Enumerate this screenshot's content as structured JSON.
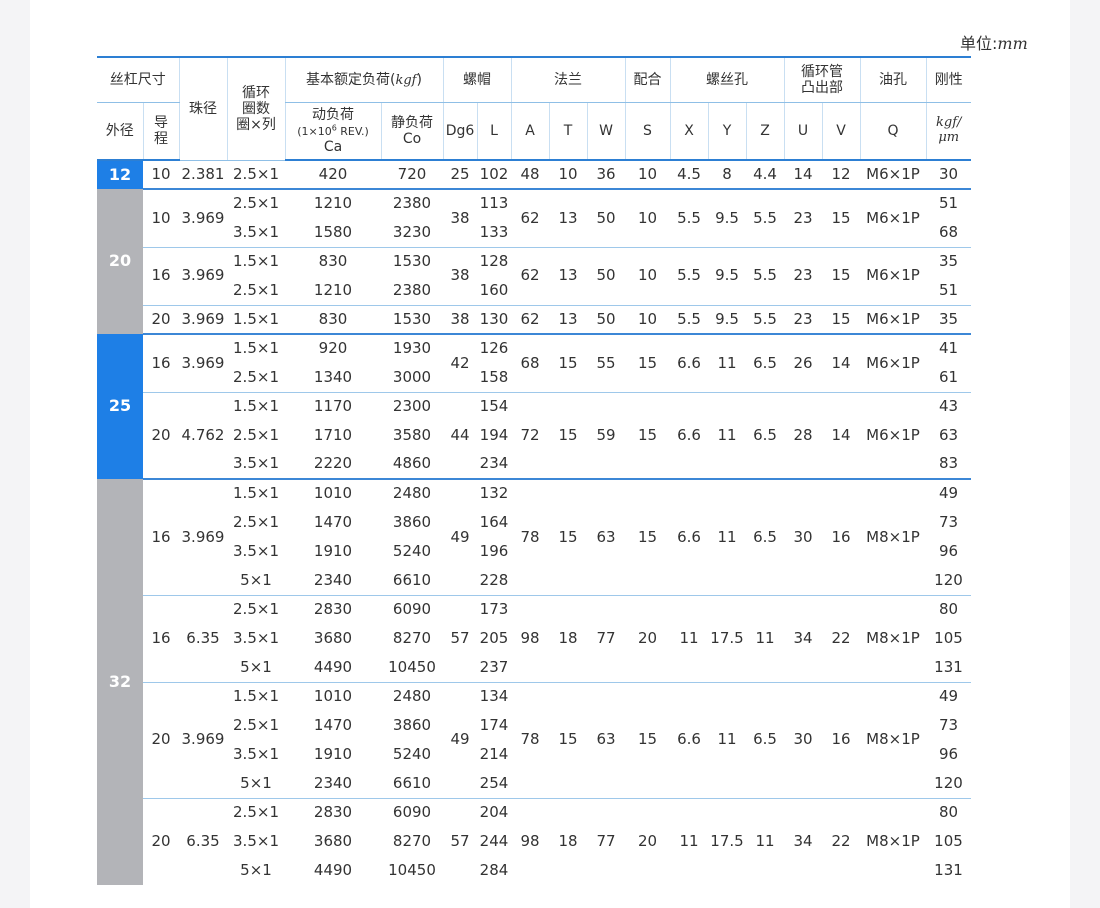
{
  "unit": {
    "label": "单位:",
    "value": "mm"
  },
  "header": {
    "screw_size": "丝杠尺寸",
    "ball_dia": "珠径",
    "circuits": [
      "循环",
      "圈数",
      "圈×列"
    ],
    "load": "基本额定负荷(",
    "load_unit": "kgf",
    "load_close": ")",
    "nut": "螺帽",
    "flange": "法兰",
    "fit": "配合",
    "bolt_hole": "螺丝孔",
    "return_tube": [
      "循环管",
      "凸出部"
    ],
    "oil_hole": "油孔",
    "stiffness": "刚性",
    "od": "外径",
    "lead": [
      "导",
      "程"
    ],
    "dyn": [
      "动负荷",
      "(1×10",
      "6",
      " REV.)",
      "Ca"
    ],
    "stat": [
      "静负荷",
      "Co"
    ],
    "sub": [
      "Dg6",
      "L",
      "A",
      "T",
      "W",
      "S",
      "X",
      "Y",
      "Z",
      "U",
      "V",
      "Q"
    ],
    "stiff_unit": [
      "kgf/",
      "μm"
    ]
  },
  "groups": [
    {
      "od": "12",
      "color": "#1e7fe6",
      "leads": [
        {
          "lead": "10",
          "ball": "2.381",
          "dg6": "25",
          "A": "48",
          "T": "10",
          "W": "36",
          "S": "10",
          "X": "4.5",
          "Y": "8",
          "Z": "4.4",
          "U": "14",
          "V": "12",
          "Q": "M6×1P",
          "rows": [
            {
              "c": "2.5×1",
              "ca": "420",
              "co": "720",
              "L": "102",
              "k": "30"
            }
          ]
        }
      ]
    },
    {
      "od": "20",
      "color": "#b3b4b8",
      "leads": [
        {
          "lead": "10",
          "ball": "3.969",
          "dg6": "38",
          "A": "62",
          "T": "13",
          "W": "50",
          "S": "10",
          "X": "5.5",
          "Y": "9.5",
          "Z": "5.5",
          "U": "23",
          "V": "15",
          "Q": "M6×1P",
          "rows": [
            {
              "c": "2.5×1",
              "ca": "1210",
              "co": "2380",
              "L": "113",
              "k": "51"
            },
            {
              "c": "3.5×1",
              "ca": "1580",
              "co": "3230",
              "L": "133",
              "k": "68"
            }
          ]
        },
        {
          "lead": "16",
          "ball": "3.969",
          "dg6": "38",
          "A": "62",
          "T": "13",
          "W": "50",
          "S": "10",
          "X": "5.5",
          "Y": "9.5",
          "Z": "5.5",
          "U": "23",
          "V": "15",
          "Q": "M6×1P",
          "rows": [
            {
              "c": "1.5×1",
              "ca": "830",
              "co": "1530",
              "L": "128",
              "k": "35"
            },
            {
              "c": "2.5×1",
              "ca": "1210",
              "co": "2380",
              "L": "160",
              "k": "51"
            }
          ]
        },
        {
          "lead": "20",
          "ball": "3.969",
          "dg6": "38",
          "A": "62",
          "T": "13",
          "W": "50",
          "S": "10",
          "X": "5.5",
          "Y": "9.5",
          "Z": "5.5",
          "U": "23",
          "V": "15",
          "Q": "M6×1P",
          "rows": [
            {
              "c": "1.5×1",
              "ca": "830",
              "co": "1530",
              "L": "130",
              "k": "35"
            }
          ]
        }
      ]
    },
    {
      "od": "25",
      "color": "#1e7fe6",
      "leads": [
        {
          "lead": "16",
          "ball": "3.969",
          "dg6": "42",
          "A": "68",
          "T": "15",
          "W": "55",
          "S": "15",
          "X": "6.6",
          "Y": "11",
          "Z": "6.5",
          "U": "26",
          "V": "14",
          "Q": "M6×1P",
          "rows": [
            {
              "c": "1.5×1",
              "ca": "920",
              "co": "1930",
              "L": "126",
              "k": "41"
            },
            {
              "c": "2.5×1",
              "ca": "1340",
              "co": "3000",
              "L": "158",
              "k": "61"
            }
          ]
        },
        {
          "lead": "20",
          "ball": "4.762",
          "dg6": "44",
          "A": "72",
          "T": "15",
          "W": "59",
          "S": "15",
          "X": "6.6",
          "Y": "11",
          "Z": "6.5",
          "U": "28",
          "V": "14",
          "Q": "M6×1P",
          "rows": [
            {
              "c": "1.5×1",
              "ca": "1170",
              "co": "2300",
              "L": "154",
              "k": "43"
            },
            {
              "c": "2.5×1",
              "ca": "1710",
              "co": "3580",
              "L": "194",
              "k": "63"
            },
            {
              "c": "3.5×1",
              "ca": "2220",
              "co": "4860",
              "L": "234",
              "k": "83"
            }
          ]
        }
      ]
    },
    {
      "od": "32",
      "color": "#b3b4b8",
      "leads": [
        {
          "lead": "16",
          "ball": "3.969",
          "dg6": "49",
          "A": "78",
          "T": "15",
          "W": "63",
          "S": "15",
          "X": "6.6",
          "Y": "11",
          "Z": "6.5",
          "U": "30",
          "V": "16",
          "Q": "M8×1P",
          "rows": [
            {
              "c": "1.5×1",
              "ca": "1010",
              "co": "2480",
              "L": "132",
              "k": "49"
            },
            {
              "c": "2.5×1",
              "ca": "1470",
              "co": "3860",
              "L": "164",
              "k": "73"
            },
            {
              "c": "3.5×1",
              "ca": "1910",
              "co": "5240",
              "L": "196",
              "k": "96"
            },
            {
              "c": "5×1",
              "ca": "2340",
              "co": "6610",
              "L": "228",
              "k": "120"
            }
          ]
        },
        {
          "lead": "16",
          "ball": "6.35",
          "dg6": "57",
          "A": "98",
          "T": "18",
          "W": "77",
          "S": "20",
          "X": "11",
          "Y": "17.5",
          "Z": "11",
          "U": "34",
          "V": "22",
          "Q": "M8×1P",
          "rows": [
            {
              "c": "2.5×1",
              "ca": "2830",
              "co": "6090",
              "L": "173",
              "k": "80"
            },
            {
              "c": "3.5×1",
              "ca": "3680",
              "co": "8270",
              "L": "205",
              "k": "105"
            },
            {
              "c": "5×1",
              "ca": "4490",
              "co": "10450",
              "L": "237",
              "k": "131"
            }
          ]
        },
        {
          "lead": "20",
          "ball": "3.969",
          "dg6": "49",
          "A": "78",
          "T": "15",
          "W": "63",
          "S": "15",
          "X": "6.6",
          "Y": "11",
          "Z": "6.5",
          "U": "30",
          "V": "16",
          "Q": "M8×1P",
          "rows": [
            {
              "c": "1.5×1",
              "ca": "1010",
              "co": "2480",
              "L": "134",
              "k": "49"
            },
            {
              "c": "2.5×1",
              "ca": "1470",
              "co": "3860",
              "L": "174",
              "k": "73"
            },
            {
              "c": "3.5×1",
              "ca": "1910",
              "co": "5240",
              "L": "214",
              "k": "96"
            },
            {
              "c": "5×1",
              "ca": "2340",
              "co": "6610",
              "L": "254",
              "k": "120"
            }
          ]
        },
        {
          "lead": "20",
          "ball": "6.35",
          "dg6": "57",
          "A": "98",
          "T": "18",
          "W": "77",
          "S": "20",
          "X": "11",
          "Y": "17.5",
          "Z": "11",
          "U": "34",
          "V": "22",
          "Q": "M8×1P",
          "rows": [
            {
              "c": "2.5×1",
              "ca": "2830",
              "co": "6090",
              "L": "204",
              "k": "80"
            },
            {
              "c": "3.5×1",
              "ca": "3680",
              "co": "8270",
              "L": "244",
              "k": "105"
            },
            {
              "c": "5×1",
              "ca": "4490",
              "co": "10450",
              "L": "284",
              "k": "131"
            }
          ]
        }
      ]
    }
  ]
}
